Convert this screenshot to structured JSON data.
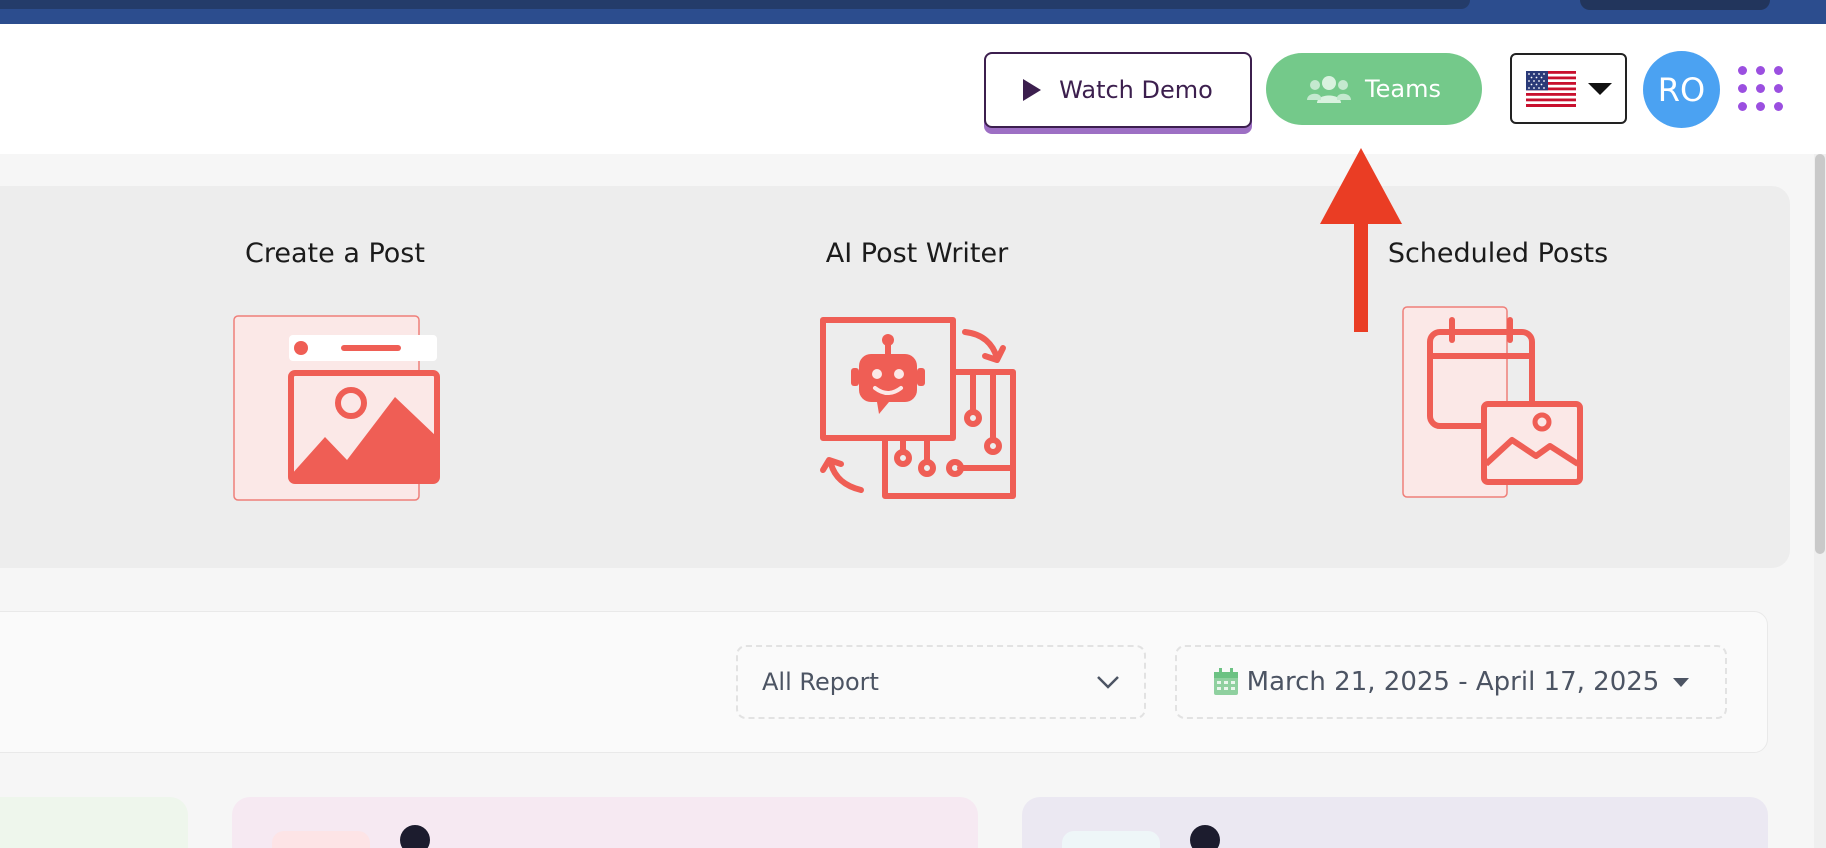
{
  "header": {
    "watch_demo_label": "Watch Demo",
    "teams_label": "Teams",
    "language_flag": "us-flag",
    "avatar_initials": "RO",
    "apps_icon": "grid-dots-icon"
  },
  "quick_actions": [
    {
      "title": "Create a Post",
      "icon": "image-post-icon"
    },
    {
      "title": "AI Post Writer",
      "icon": "robot-circuit-icon"
    },
    {
      "title": "Scheduled Posts",
      "icon": "calendar-image-icon"
    }
  ],
  "filters": {
    "report_select": "All Report",
    "date_range": "March 21, 2025 - April 17, 2025"
  },
  "colors": {
    "brand_navy": "#2c4d8e",
    "teams_green": "#74c98a",
    "accent_red": "#ef5e55",
    "avatar_blue": "#4ba2f2",
    "dots_purple": "#9b4fe0"
  },
  "annotation": {
    "arrow_icon": "red-arrow-up-icon"
  }
}
